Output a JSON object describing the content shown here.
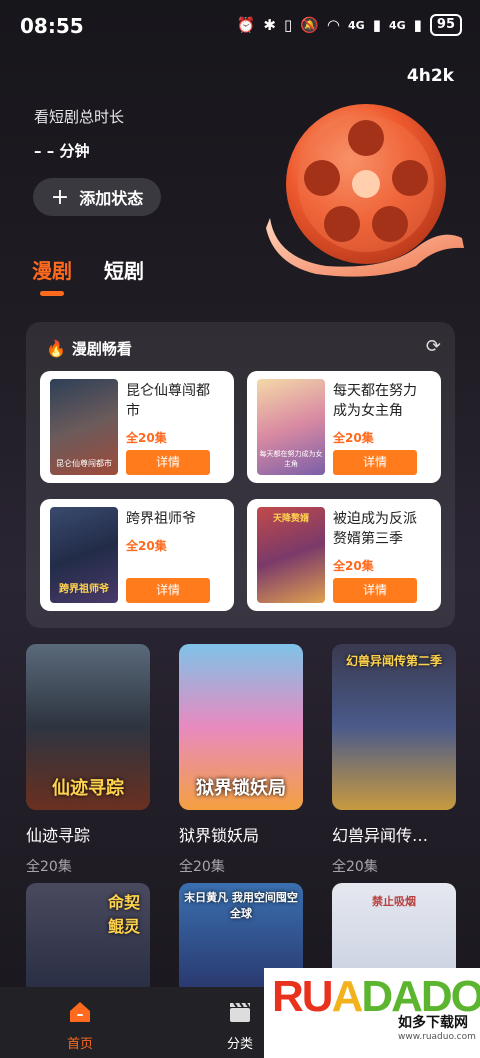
{
  "status_bar": {
    "time": "08:55",
    "network_1": "4G",
    "network_2": "4G",
    "battery": "95"
  },
  "header": {
    "watch_time": "4h2k",
    "total_label": "看短剧总时长",
    "total_value": "– –  分钟",
    "add_status_label": "添加状态"
  },
  "tabs": [
    {
      "label": "漫剧",
      "active": true
    },
    {
      "label": "短剧",
      "active": false
    }
  ],
  "featured": {
    "title": "漫剧畅看",
    "cards": [
      {
        "title": "昆仑仙尊闯都市",
        "episodes": "全20集",
        "button": "详情",
        "cover_text": "昆仑仙尊闯都市"
      },
      {
        "title": "每天都在努力成为女主角",
        "episodes": "全20集",
        "button": "详情",
        "cover_text": "每天都在努力成为女主角"
      },
      {
        "title": "跨界祖师爷",
        "episodes": "全20集",
        "button": "详情",
        "cover_text": "跨界祖师爷"
      },
      {
        "title": "被迫成为反派赘婿第三季",
        "episodes": "全20集",
        "button": "详情",
        "cover_text": "天降赘婿"
      }
    ]
  },
  "grid": [
    {
      "title": "仙迹寻踪",
      "episodes": "全20集",
      "caption": "仙迹寻踪"
    },
    {
      "title": "狱界锁妖局",
      "episodes": "全20集",
      "caption": "狱界锁妖局"
    },
    {
      "title": "幻兽异闻传…",
      "episodes": "全20集",
      "caption": "幻兽异闻传第二季"
    },
    {
      "title": "",
      "episodes": "",
      "caption": "命契鲲灵"
    },
    {
      "title": "",
      "episodes": "",
      "caption": "末日黄凡 我用空间囤空全球"
    },
    {
      "title": "",
      "episodes": "",
      "caption": "禁止吸烟"
    }
  ],
  "bottom_nav": [
    {
      "label": "首页",
      "active": true
    },
    {
      "label": "分类",
      "active": false
    }
  ],
  "watermark": {
    "logo": "RUADADO",
    "subtitle": "如多下载网",
    "url": "www.ruaduo.com"
  },
  "colors": {
    "accent": "#ff6a1f",
    "button": "#ff7b1c",
    "background": "#1f1c23"
  }
}
